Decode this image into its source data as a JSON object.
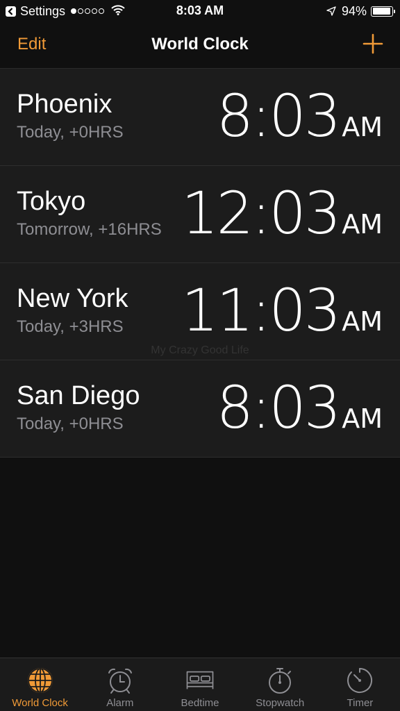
{
  "status_bar": {
    "back_label": "Settings",
    "time": "8:03 AM",
    "battery": "94%",
    "battery_level": 0.94,
    "signal_bars_filled": 1,
    "signal_bars_total": 5
  },
  "nav": {
    "edit_label": "Edit",
    "title": "World Clock",
    "add_icon": "plus-icon"
  },
  "clocks": [
    {
      "city": "Phoenix",
      "offset": "Today, +0HRS",
      "time": "8:03",
      "ampm": "AM"
    },
    {
      "city": "Tokyo",
      "offset": "Tomorrow, +16HRS",
      "time": "12:03",
      "ampm": "AM"
    },
    {
      "city": "New York",
      "offset": "Today, +3HRS",
      "time": "11:03",
      "ampm": "AM"
    },
    {
      "city": "San Diego",
      "offset": "Today, +0HRS",
      "time": "8:03",
      "ampm": "AM"
    }
  ],
  "watermark": "My Crazy Good Life",
  "tabs": [
    {
      "label": "World Clock",
      "icon": "globe-icon",
      "active": true
    },
    {
      "label": "Alarm",
      "icon": "alarm-clock-icon",
      "active": false
    },
    {
      "label": "Bedtime",
      "icon": "bed-icon",
      "active": false
    },
    {
      "label": "Stopwatch",
      "icon": "stopwatch-icon",
      "active": false
    },
    {
      "label": "Timer",
      "icon": "timer-icon",
      "active": false
    }
  ],
  "colors": {
    "accent": "#f09a37",
    "background": "#101010",
    "row_background": "#1c1c1c",
    "secondary_text": "#8e8e93"
  }
}
